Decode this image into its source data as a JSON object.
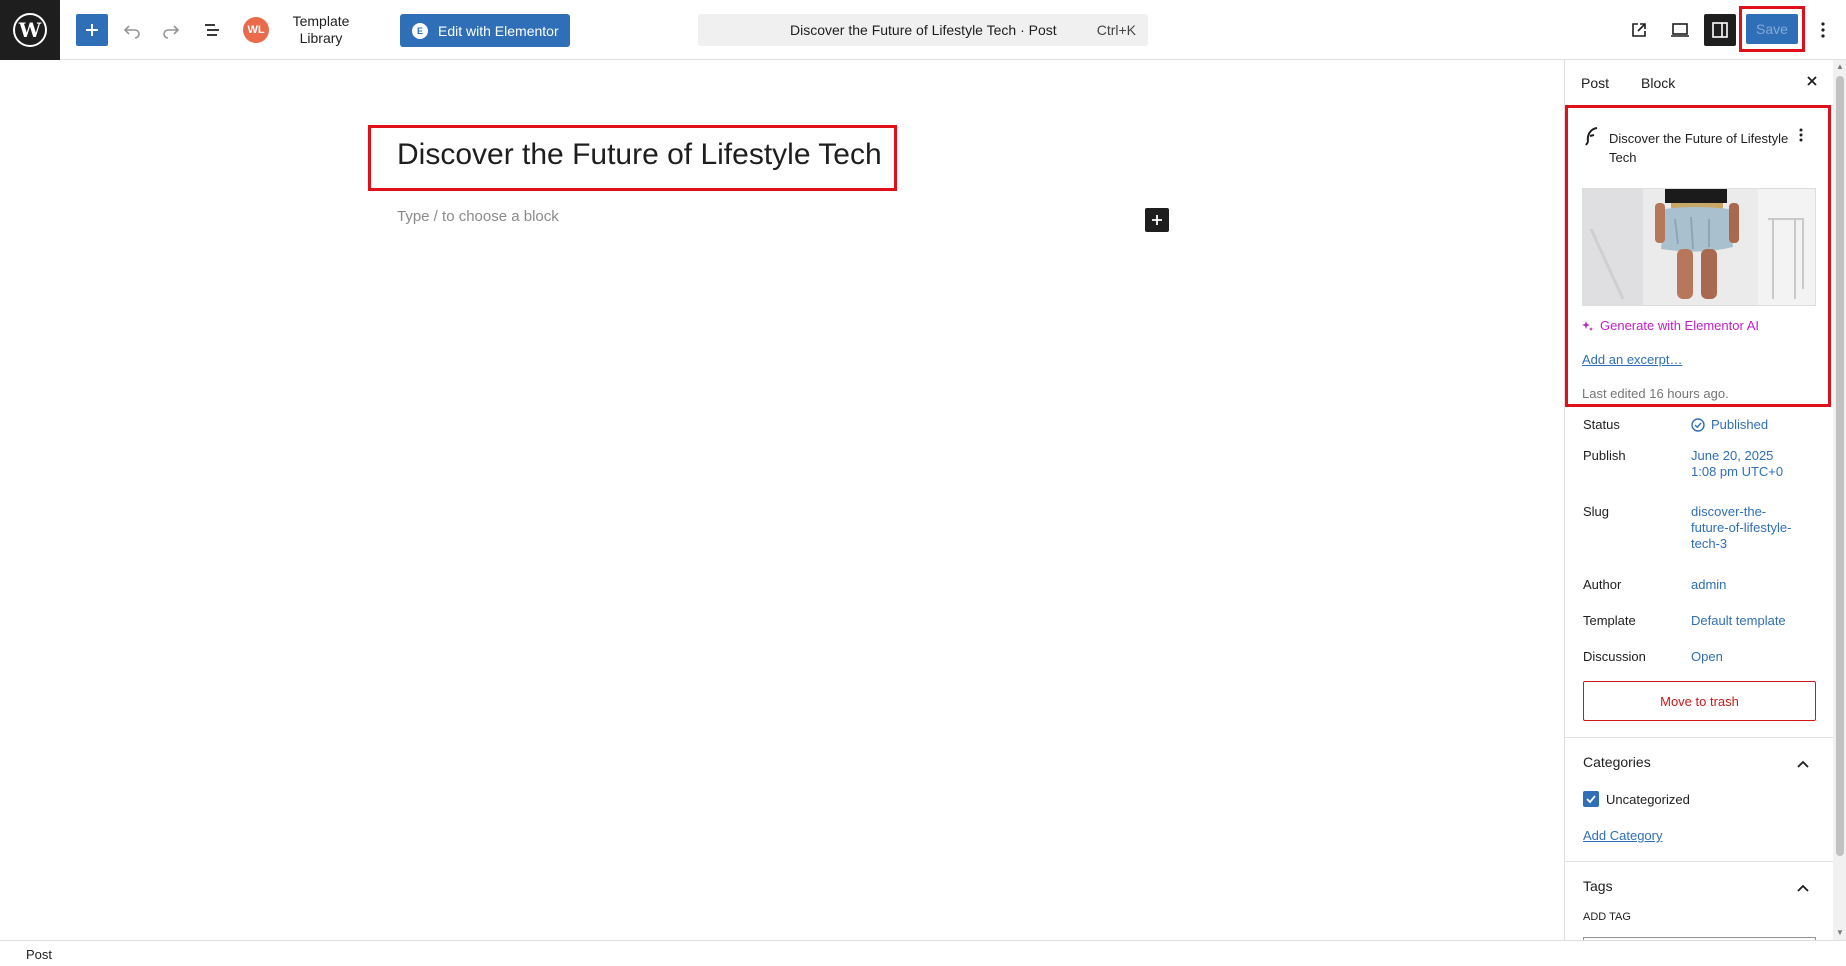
{
  "toolbar": {
    "template_library": "Template\nLibrary",
    "template_library_l1": "Template",
    "template_library_l2": "Library",
    "wl_badge": "WL",
    "edit_elementor": "Edit with Elementor",
    "command_title": "Discover the Future of Lifestyle Tech · Post",
    "command_shortcut": "Ctrl+K",
    "save": "Save"
  },
  "editor": {
    "post_title": "Discover the Future of Lifestyle Tech",
    "block_placeholder": "Type / to choose a block"
  },
  "sidebar": {
    "tabs": [
      "Post",
      "Block"
    ],
    "summary": {
      "title": "Discover the Future of Lifestyle Tech",
      "generate_ai": "Generate with Elementor AI",
      "add_excerpt": "Add an excerpt…",
      "last_edited": "Last edited 16 hours ago."
    },
    "fields": {
      "status_label": "Status",
      "status_value": "Published",
      "publish_label": "Publish",
      "publish_value_1": "June 20, 2025",
      "publish_value_2": "1:08 pm UTC+0",
      "slug_label": "Slug",
      "slug_value_1": "discover-the-",
      "slug_value_2": "future-of-lifestyle-",
      "slug_value_3": "tech-3",
      "author_label": "Author",
      "author_value": "admin",
      "template_label": "Template",
      "template_value": "Default template",
      "discussion_label": "Discussion",
      "discussion_value": "Open"
    },
    "move_to_trash": "Move to trash",
    "categories": {
      "title": "Categories",
      "items": [
        {
          "label": "Uncategorized",
          "checked": true
        }
      ],
      "add_category": "Add Category"
    },
    "tags": {
      "title": "Tags",
      "add_tag_label": "ADD TAG"
    }
  },
  "footer": {
    "breadcrumb": "Post"
  },
  "colors": {
    "accent": "#2f6fb7",
    "highlight_box": "#e0101a",
    "ai_magenta": "#c21fc4",
    "trash_red": "#cc1818"
  }
}
